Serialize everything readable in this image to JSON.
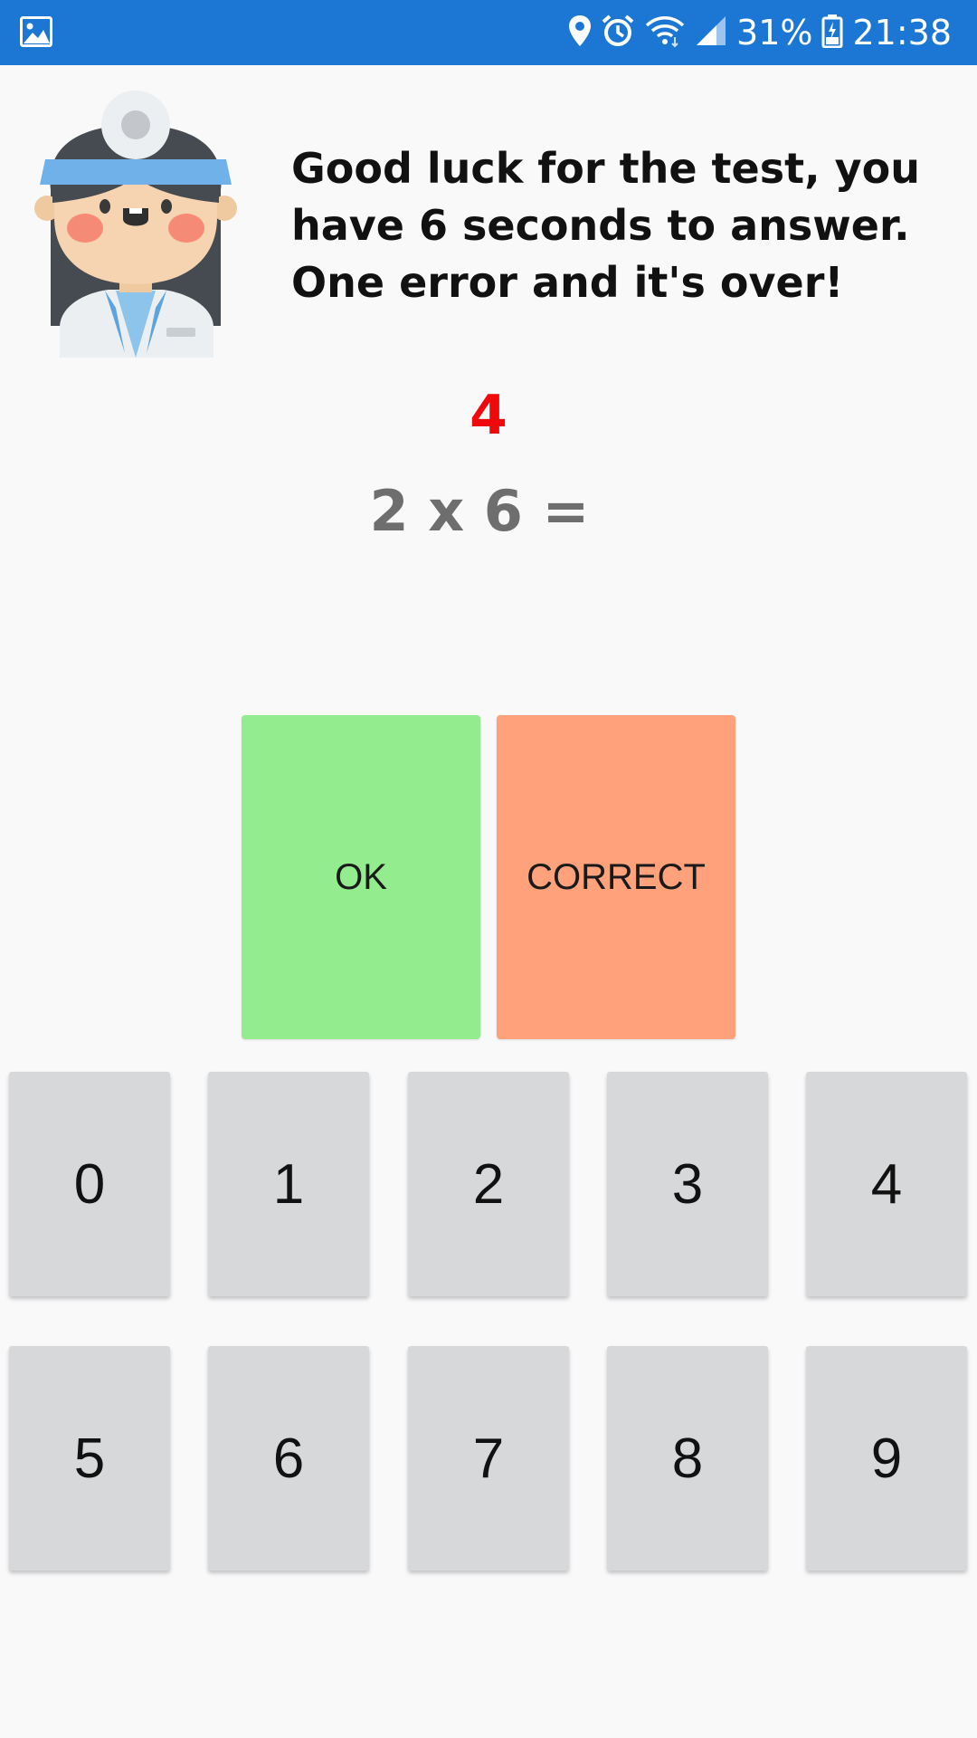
{
  "status_bar": {
    "icons": [
      "gallery-icon",
      "location-icon",
      "alarm-icon",
      "wifi-icon",
      "signal-icon",
      "battery-icon"
    ],
    "battery_percent": "31%",
    "time": "21:38",
    "background_color": "#1c77d4"
  },
  "main": {
    "avatar_icon": "doctor-avatar",
    "message": "Good luck for the test, you have 6 seconds to answer. One error and it's over!",
    "timer": "4",
    "timer_color": "#ee0a0a",
    "equation": "2 x 6 ="
  },
  "actions": {
    "ok_label": "OK",
    "ok_color": "#93ec8e",
    "correct_label": "CORRECT",
    "correct_color": "#ffa27c"
  },
  "keypad": {
    "keys": [
      "0",
      "1",
      "2",
      "3",
      "4",
      "5",
      "6",
      "7",
      "8",
      "9"
    ]
  }
}
